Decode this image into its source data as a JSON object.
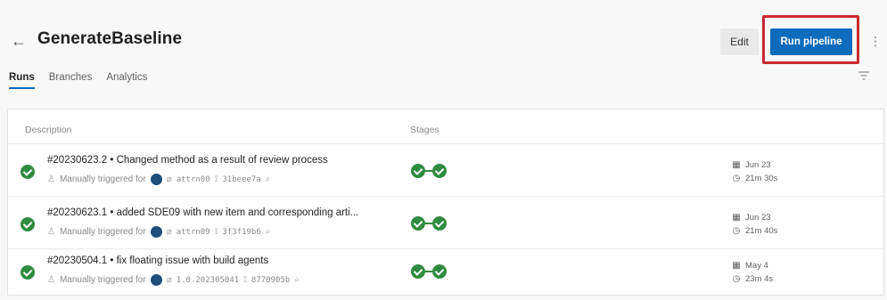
{
  "header": {
    "title": "GenerateBaseline",
    "edit_label": "Edit",
    "run_label": "Run pipeline"
  },
  "tabs": [
    {
      "label": "Runs",
      "active": true
    },
    {
      "label": "Branches",
      "active": false
    },
    {
      "label": "Analytics",
      "active": false
    }
  ],
  "table": {
    "columns": {
      "description": "Description",
      "stages": "Stages"
    },
    "rows": [
      {
        "title": "#20230623.2 • Changed method as a result of review process",
        "trigger": "Manually triggered for",
        "branch": "attrn00",
        "commit": "31beee7a",
        "date": "Jun 23",
        "duration": "21m 30s",
        "status": "succeeded"
      },
      {
        "title": "#20230623.1 • added SDE09 with new item and corresponding arti...",
        "trigger": "Manually triggered for",
        "branch": "attrn09",
        "commit": "3f3f19b6",
        "date": "Jun 23",
        "duration": "21m 40s",
        "status": "succeeded"
      },
      {
        "title": "#20230504.1 • fix floating issue with build agents",
        "trigger": "Manually triggered for",
        "branch": "1.0.202305041",
        "commit": "8770905b",
        "date": "May 4",
        "duration": "23m 4s",
        "status": "succeeded"
      }
    ]
  },
  "icons": {
    "back": "arrow-left-icon",
    "more": "more-vertical-icon",
    "filter": "filter-icon",
    "status": "check-circle-icon",
    "calendar": "calendar-icon",
    "clock": "clock-icon"
  },
  "colors": {
    "accent": "#0f6cbd",
    "success": "#2e8b3f",
    "highlight": "#c8292f"
  }
}
